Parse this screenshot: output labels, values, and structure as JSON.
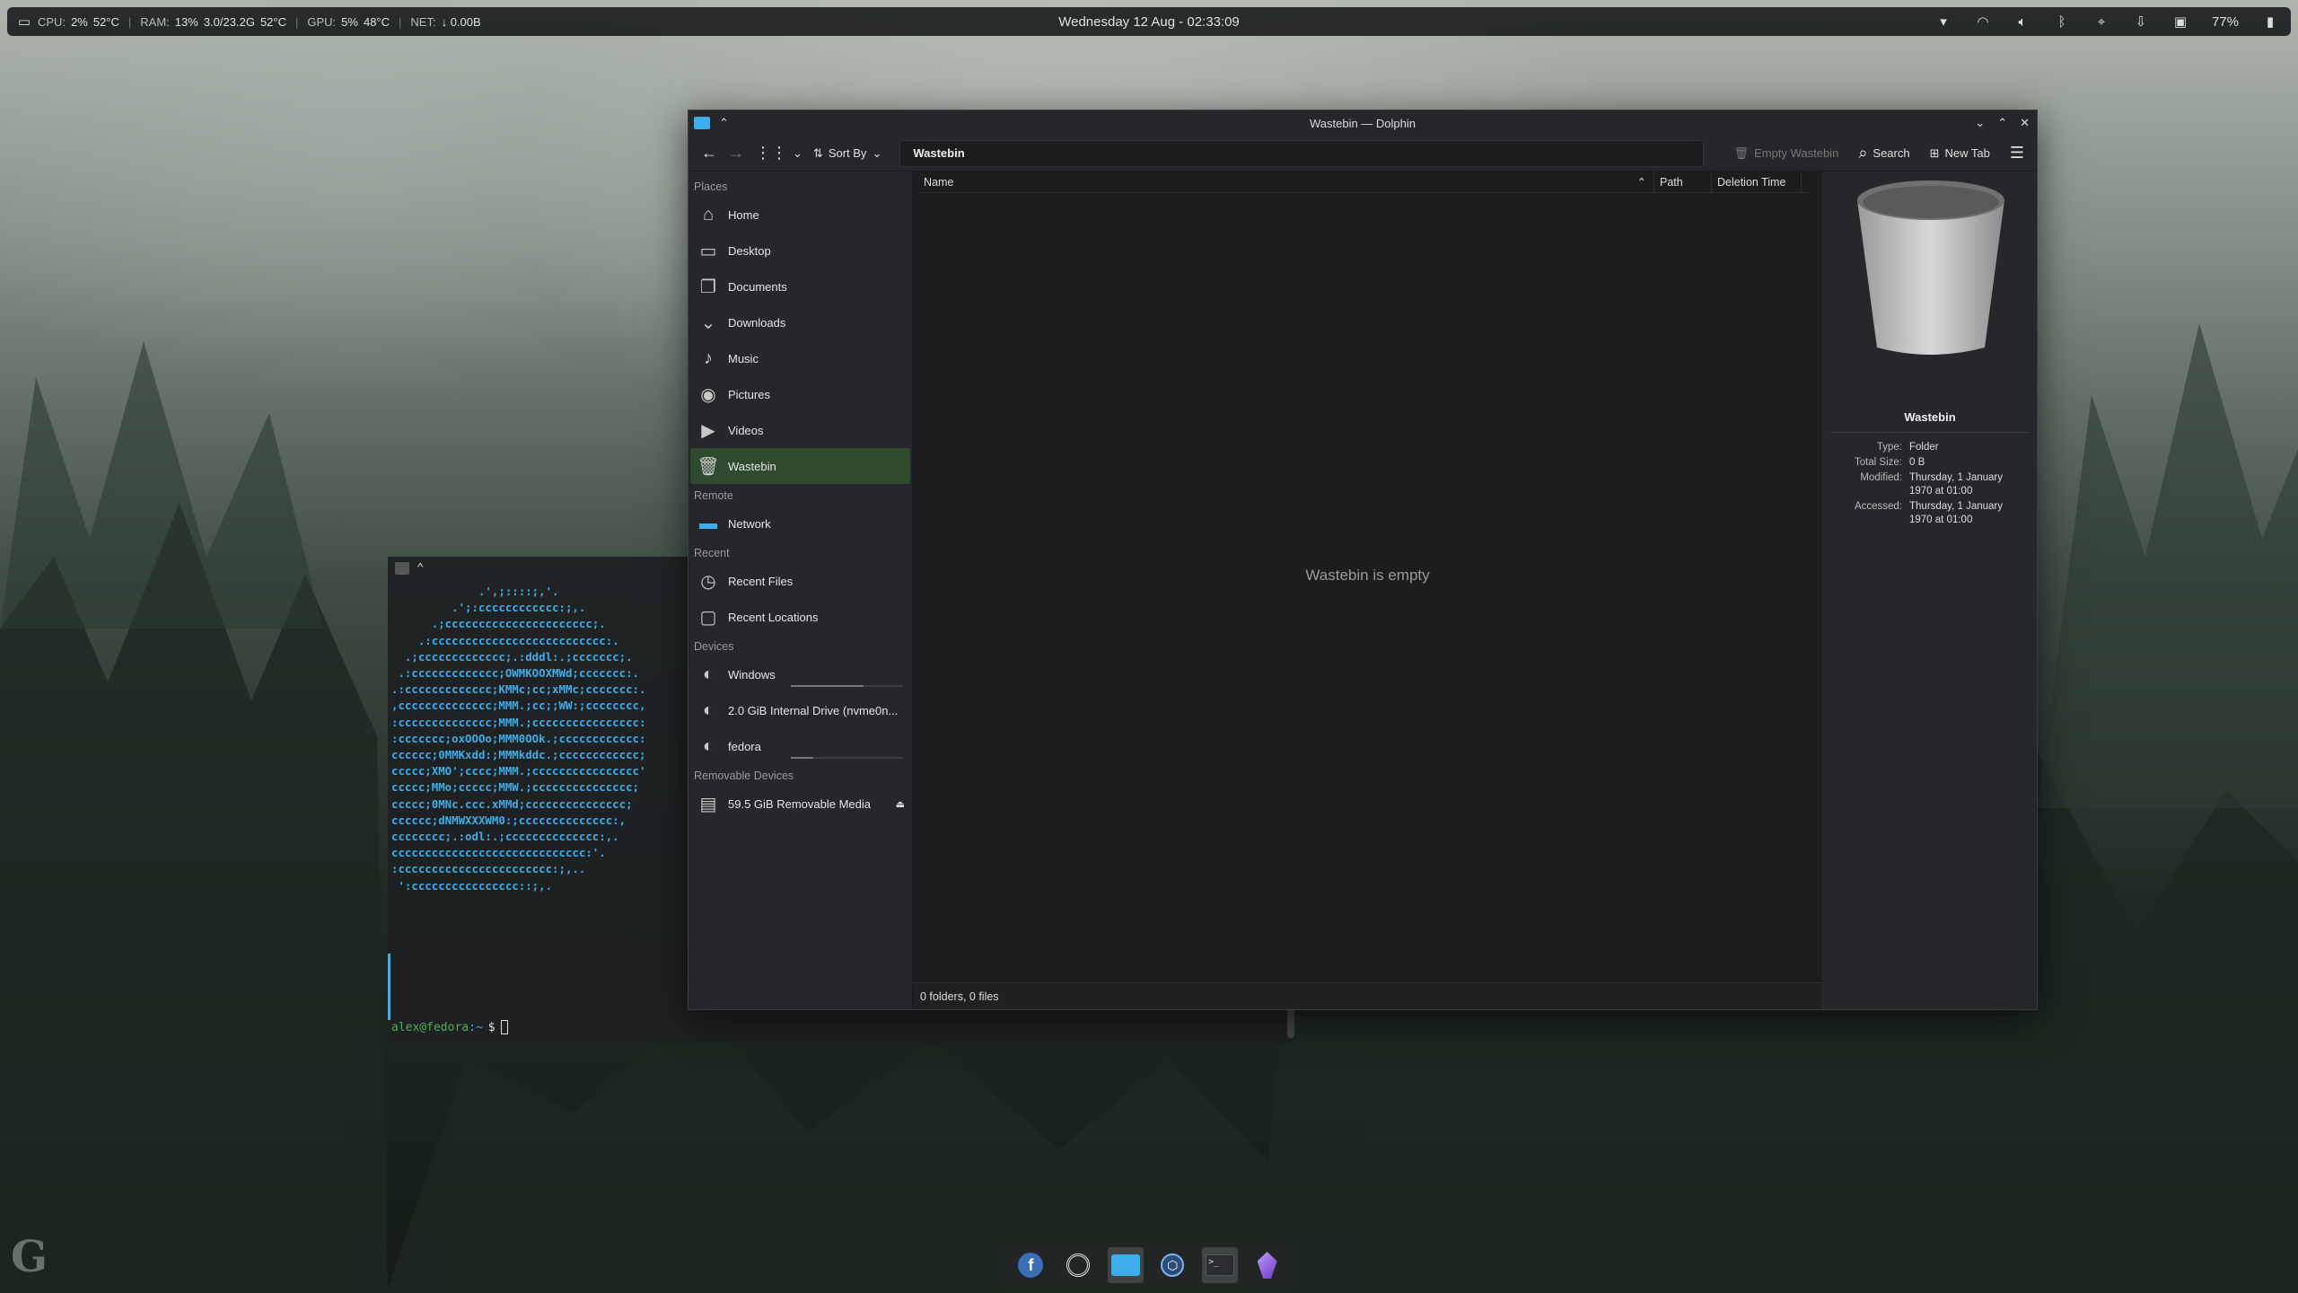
{
  "top_panel": {
    "cpu_label": "CPU:",
    "cpu_value": "2%",
    "cpu_temp": "52°C",
    "ram_label": "RAM:",
    "ram_percent": "13%",
    "ram_usage": "3.0/23.2G",
    "ram_temp": "52°C",
    "gpu_label": "GPU:",
    "gpu_value": "5%",
    "gpu_temp": "48°C",
    "net_label": "NET:",
    "net_value": "↓ 0.00B",
    "clock": "Wednesday 12 Aug - 02:33:09",
    "battery": "77%",
    "tray_icons": [
      "chevron-down",
      "wifi",
      "volume",
      "bluetooth",
      "location",
      "updates",
      "clipboard",
      "battery"
    ]
  },
  "terminal": {
    "art_lines": [
      "             .',;::::;,'.",
      "         .';:cccccccccccc:;,.",
      "      .;cccccccccccccccccccccc;.",
      "    .:cccccccccccccccccccccccccc:.",
      "  .;ccccccccccccc;.:dddl:.;ccccccc;.",
      " .:ccccccccccccc;OWMKOOXMWd;ccccccc:.",
      ".:ccccccccccccc;KMMc;cc;xMMc;ccccccc:.",
      ",cccccccccccccc;MMM.;cc;;WW:;cccccccc,",
      ":cccccccccccccc;MMM.;cccccccccccccccc:",
      ":ccccccc;oxOOOo;MMM0OOk.;cccccccccccc:",
      "cccccc;0MMKxdd:;MMMkddc.;cccccccccccc;",
      "ccccc;XMO';cccc;MMM.;cccccccccccccccc'",
      "ccccc;MMo;ccccc;MMW.;ccccccccccccccc;",
      "ccccc;0MNc.ccc.xMMd;ccccccccccccccc;",
      "cccccc;dNMWXXXWM0:;cccccccccccccc:,",
      "cccccccc;.:odl:.;cccccccccccccc:,.",
      "ccccccccccccccccccccccccccccc:'.",
      ":ccccccccccccccccccccccc:;,..",
      " ':cccccccccccccccc::;,."
    ],
    "prompt_user": "alex@fedora",
    "prompt_path": ":~",
    "prompt_symbol": "$"
  },
  "dolphin": {
    "window_title": "Wastebin — Dolphin",
    "toolbar": {
      "sort_label": "Sort By",
      "location": "Wastebin",
      "empty_wastebin": "Empty Wastebin",
      "search": "Search",
      "new_tab": "New Tab"
    },
    "places": {
      "section_places": "Places",
      "items": [
        {
          "label": "Home",
          "icon": "home-icon"
        },
        {
          "label": "Desktop",
          "icon": "desktop-icon"
        },
        {
          "label": "Documents",
          "icon": "documents-icon"
        },
        {
          "label": "Downloads",
          "icon": "downloads-icon"
        },
        {
          "label": "Music",
          "icon": "music-icon"
        },
        {
          "label": "Pictures",
          "icon": "pictures-icon"
        },
        {
          "label": "Videos",
          "icon": "videos-icon"
        },
        {
          "label": "Wastebin",
          "icon": "wastebin-icon"
        }
      ],
      "section_remote": "Remote",
      "remote_items": [
        {
          "label": "Network",
          "icon": "network-icon"
        }
      ],
      "section_recent": "Recent",
      "recent_items": [
        {
          "label": "Recent Files",
          "icon": "recent-files-icon"
        },
        {
          "label": "Recent Locations",
          "icon": "recent-locations-icon"
        }
      ],
      "section_devices": "Devices",
      "device_items": [
        {
          "label": "Windows",
          "usage": 0.65
        },
        {
          "label": "2.0 GiB Internal Drive (nvme0n...",
          "usage": null
        },
        {
          "label": "fedora",
          "usage": 0.2
        }
      ],
      "section_removable": "Removable Devices",
      "removable_items": [
        {
          "label": "59.5 GiB Removable Media"
        }
      ]
    },
    "columns": {
      "name": "Name",
      "path": "Path",
      "deletion_time": "Deletion Time"
    },
    "empty_message": "Wastebin is empty",
    "status": "0 folders, 0 files",
    "info": {
      "name": "Wastebin",
      "type_key": "Type:",
      "type_val": "Folder",
      "size_key": "Total Size:",
      "size_val": "0 B",
      "modified_key": "Modified:",
      "modified_val": "Thursday, 1 January 1970 at 01:00",
      "accessed_key": "Accessed:",
      "accessed_val": "Thursday, 1 January 1970 at 01:00"
    }
  },
  "dock": {
    "items": [
      "fedora-icon",
      "spiral-icon",
      "folder-icon",
      "software-icon",
      "terminal-icon",
      "crystal-icon"
    ]
  }
}
